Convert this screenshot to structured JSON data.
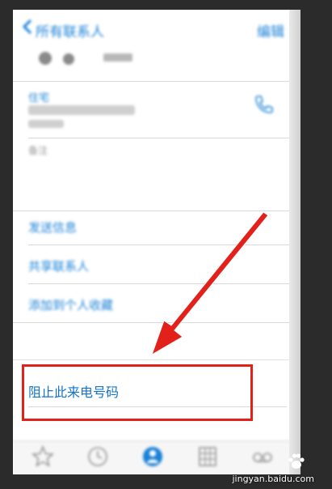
{
  "nav": {
    "back_label": "所有联系人",
    "edit_label": "编辑"
  },
  "contact": {
    "field_label": "住宅",
    "notes_label": "备注"
  },
  "actions": {
    "send_message": "发送信息",
    "share_contact": "共享联系人",
    "add_favorite": "添加到个人收藏",
    "block_caller": "阻止此来电号码"
  },
  "tabbar": {
    "items": [
      {
        "label": "个人收藏",
        "icon": "star-icon"
      },
      {
        "label": "最近通话",
        "icon": "clock-icon"
      },
      {
        "label": "通讯录",
        "icon": "contacts-icon"
      },
      {
        "label": "拨号键盘",
        "icon": "keypad-icon"
      },
      {
        "label": "语音留言",
        "icon": "voicemail-icon"
      }
    ]
  },
  "watermark": {
    "text": "jingyan.baidu.com"
  },
  "colors": {
    "accent": "#1a82d6",
    "highlight": "#e2221a",
    "arrow": "#e2221a"
  }
}
